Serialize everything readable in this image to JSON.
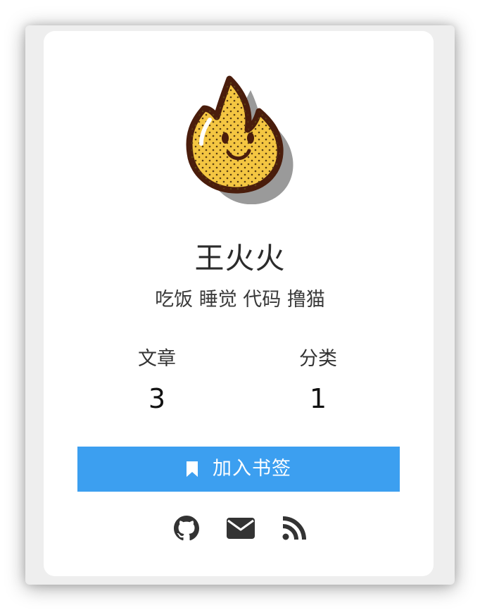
{
  "profile": {
    "name": "王火火",
    "bio": "吃饭 睡觉 代码 撸猫",
    "avatar_icon": "fire-face-avatar"
  },
  "stats": {
    "articles_label": "文章",
    "articles_value": "3",
    "categories_label": "分类",
    "categories_value": "1"
  },
  "bookmark_button": {
    "label": "加入书签",
    "icon": "bookmark-icon"
  },
  "social_links": [
    {
      "icon": "github-icon"
    },
    {
      "icon": "email-icon"
    },
    {
      "icon": "rss-icon"
    }
  ],
  "colors": {
    "accent": "#3c9ff0",
    "text": "#2b2b2b",
    "icon": "#333333",
    "card_background": "#ffffff",
    "frame_background": "#eeeeee"
  }
}
